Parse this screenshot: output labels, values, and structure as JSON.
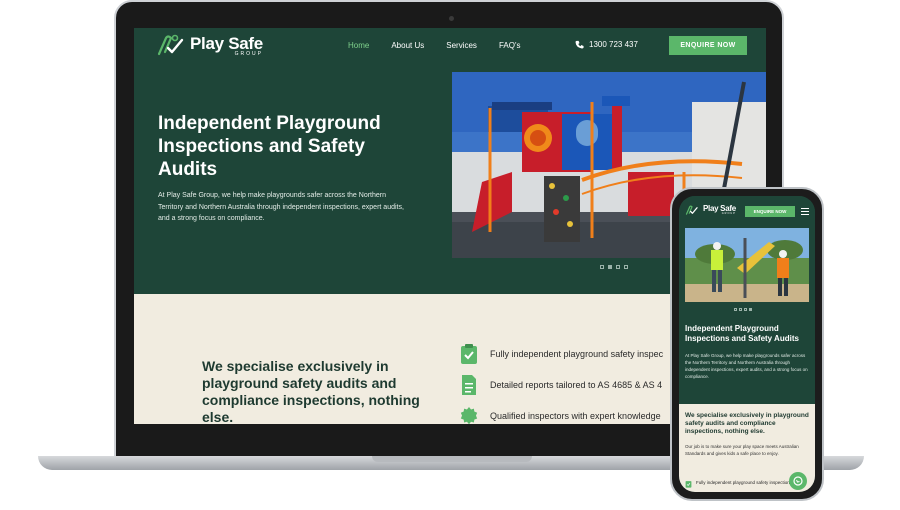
{
  "brand": {
    "name": "Play Safe",
    "sub": "GROUP",
    "accent": "#5bb76a",
    "primary": "#1e4538",
    "cream": "#f1ece0"
  },
  "desktop": {
    "nav": [
      "Home",
      "About Us",
      "Services",
      "FAQ's"
    ],
    "phone": "1300 723 437",
    "cta": "ENQUIRE NOW",
    "hero": {
      "title": "Independent Playground Inspections and Safety Audits",
      "description": "At Play Safe Group, we help make playgrounds safer across the Northern Territory and Northern Australia through independent inspections, expert audits, and a strong focus on compliance."
    },
    "section": {
      "heading": "We specialise exclusively in playground safety audits and compliance inspections, nothing else.",
      "features": [
        {
          "icon": "clipboard-check-icon",
          "text": "Fully independent playground safety inspec"
        },
        {
          "icon": "document-icon",
          "text": "Detailed reports tailored to AS 4685 & AS 4"
        },
        {
          "icon": "badge-icon",
          "text": "Qualified inspectors with expert knowledge"
        }
      ]
    },
    "carousel_dots": 4
  },
  "mobile": {
    "cta": "ENQUIRE NOW",
    "hero": {
      "title": "Independent Playground Inspections and Safety Audits",
      "description": "At Play Safe Group, we help make playgrounds safer across the Northern Territory and Northern Australia through independent inspections, expert audits, and a strong focus on compliance."
    },
    "section": {
      "heading": "We specialise exclusively in playground safety audits and compliance inspections, nothing else.",
      "body": "Our job is to make sure your play space meets Australian Standards and gives kids a safe place to enjoy.",
      "feature": "Fully independent playground safety inspections"
    }
  }
}
